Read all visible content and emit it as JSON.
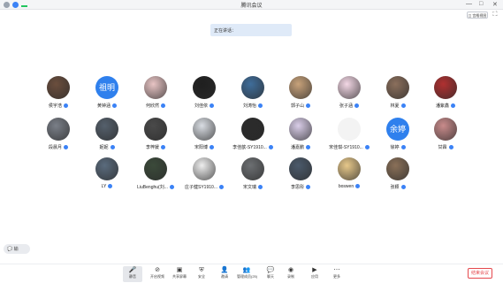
{
  "window": {
    "title": "腾讯会议",
    "view_label": "◫ 宫格视图",
    "minimize": "—",
    "maximize": "□",
    "close": "✕",
    "fullscreen": "⛶"
  },
  "speaking": {
    "label": "正在讲话："
  },
  "participants": [
    {
      "name": "侯宇浩",
      "avatar": "photo"
    },
    {
      "name": "黄钟涵",
      "avatar": "initials",
      "initials": "祖明"
    },
    {
      "name": "何欣然",
      "avatar": "photo"
    },
    {
      "name": "刘佳依",
      "avatar": "photo"
    },
    {
      "name": "刘涛怡",
      "avatar": "photo"
    },
    {
      "name": "郭子山",
      "avatar": "photo"
    },
    {
      "name": "张子涵",
      "avatar": "photo"
    },
    {
      "name": "林夏",
      "avatar": "photo"
    },
    {
      "name": "潘紫鑫",
      "avatar": "photo"
    },
    {
      "name": "段晨月",
      "avatar": "photo"
    },
    {
      "name": "妮妮",
      "avatar": "photo"
    },
    {
      "name": "李梓媛",
      "avatar": "photo"
    },
    {
      "name": "宋阳博",
      "avatar": "photo"
    },
    {
      "name": "李佳歆-SY1910...",
      "avatar": "photo"
    },
    {
      "name": "潘嘉鹏",
      "avatar": "photo"
    },
    {
      "name": "宋佳琪-SY1910...",
      "avatar": "photo"
    },
    {
      "name": "徐婷",
      "avatar": "initials",
      "initials": "余婷"
    },
    {
      "name": "甘霖",
      "avatar": "photo"
    },
    {
      "name": "LY",
      "avatar": "photo"
    },
    {
      "name": "LiuBenghu(刘...",
      "avatar": "photo"
    },
    {
      "name": "庄子健SY1910...",
      "avatar": "photo"
    },
    {
      "name": "宋文瑞",
      "avatar": "photo"
    },
    {
      "name": "李思彤",
      "avatar": "photo"
    },
    {
      "name": "boswen",
      "avatar": "photo"
    },
    {
      "name": "张颖",
      "avatar": "photo"
    }
  ],
  "chat": {
    "label": "💬 输"
  },
  "toolbar": {
    "items": [
      {
        "icon": "microphone-icon",
        "glyph": "🎤",
        "label": "静音"
      },
      {
        "icon": "camera-off-icon",
        "glyph": "⊘",
        "label": "开启视频"
      },
      {
        "icon": "screen-share-icon",
        "glyph": "▣",
        "label": "共享屏幕"
      },
      {
        "icon": "shield-icon",
        "glyph": "⛨",
        "label": "安全"
      },
      {
        "icon": "invite-icon",
        "glyph": "👤",
        "label": "邀请"
      },
      {
        "icon": "members-icon",
        "glyph": "👥",
        "label": "管理成员(25)"
      },
      {
        "icon": "chat-icon",
        "glyph": "💬",
        "label": "聊天"
      },
      {
        "icon": "record-icon",
        "glyph": "◉",
        "label": "录制"
      },
      {
        "icon": "apps-icon",
        "glyph": "▶",
        "label": "应用"
      },
      {
        "icon": "more-icon",
        "glyph": "⋯",
        "label": "更多"
      }
    ],
    "leave_label": "结束会议"
  },
  "colors": {
    "accent": "#2f80ed",
    "danger": "#e5484d"
  }
}
